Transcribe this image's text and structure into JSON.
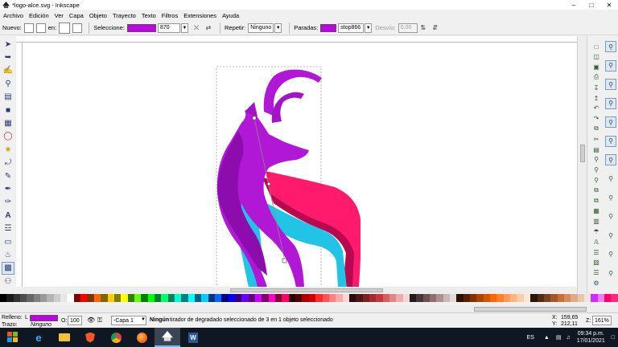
{
  "window": {
    "title": "*logo-alce.svg - Inkscape",
    "minimize_icon": "minimize-icon",
    "maximize_icon": "maximize-icon",
    "close_icon": "close-icon"
  },
  "menu": [
    "Archivo",
    "Edición",
    "Ver",
    "Capa",
    "Objeto",
    "Trayecto",
    "Texto",
    "Filtros",
    "Extensiones",
    "Ayuda"
  ],
  "tool_controls": {
    "nuevo_label": "Nuevo:",
    "en_label": "en:",
    "seleccione_label": "Seleccione:",
    "selection_color": "#c000e8",
    "selection_value": "870",
    "repetir_label": "Repetir:",
    "repetir_value": "Ninguno",
    "paradas_label": "Paradas:",
    "paradas_color": "#c000e8",
    "paradas_value": "stop866",
    "desvio_label": "Desvío:",
    "desvio_value": "0,00"
  },
  "tools": [
    "selector-icon",
    "node-icon",
    "tweak-icon",
    "zoom-icon",
    "measure-icon",
    "rectangle-icon",
    "3dbox-icon",
    "circle-icon",
    "star-icon",
    "spiral-icon",
    "pencil-icon",
    "pen-icon",
    "calligraphy-icon",
    "text-icon",
    "spray-icon",
    "eraser-icon",
    "bucket-icon",
    "gradient-icon",
    "dropper-icon"
  ],
  "commands": [
    "new-doc-icon",
    "open-icon",
    "save-icon",
    "print-icon",
    "import-icon",
    "export-icon",
    "undo-icon",
    "redo-icon",
    "copy-icon",
    "cut-icon",
    "paste-icon",
    "zoom-fit-icon",
    "zoom-drawing-icon",
    "zoom-page-icon",
    "duplicate-icon",
    "clone-icon",
    "group-icon",
    "ungroup-icon",
    "fill-stroke-icon",
    "text-font-icon",
    "layers-icon",
    "xml-editor-icon",
    "align-icon",
    "preferences-icon"
  ],
  "snap_controls": [
    "snap-enable-icon",
    "snap-bbox-icon",
    "snap-bbox-edge-icon",
    "snap-bbox-corner-icon",
    "snap-nodes-icon",
    "snap-path-icon",
    "snap-cusp-icon",
    "snap-smooth-icon",
    "snap-midpoint-icon",
    "snap-center-icon",
    "snap-rotation-icon",
    "snap-page-icon",
    "snap-grid-icon"
  ],
  "palette": [
    "#000000",
    "#1a1a1a",
    "#333333",
    "#4d4d4d",
    "#666666",
    "#808080",
    "#999999",
    "#b3b3b3",
    "#cccccc",
    "#e6e6e6",
    "#ffffff",
    "#800000",
    "#ff0000",
    "#803300",
    "#ff6600",
    "#806600",
    "#ffcc00",
    "#808000",
    "#ffff00",
    "#338000",
    "#66ff00",
    "#008000",
    "#00ff00",
    "#008033",
    "#00ff66",
    "#008066",
    "#00ffcc",
    "#008080",
    "#00ffff",
    "#006680",
    "#00ccff",
    "#003380",
    "#0066ff",
    "#000080",
    "#0000ff",
    "#330080",
    "#6600ff",
    "#660080",
    "#cc00ff",
    "#800066",
    "#ff00cc",
    "#800033",
    "#ff0066",
    "#2b0000",
    "#550000",
    "#aa0000",
    "#d40000",
    "#ff2a2a",
    "#ff5555",
    "#ff8080",
    "#ffaaaa",
    "#ffd5d5",
    "#280b0b",
    "#501616",
    "#782121",
    "#a02c2c",
    "#c83737",
    "#d35f5f",
    "#de8787",
    "#e9afaf",
    "#f4d7d7",
    "#241c1c",
    "#483737",
    "#6c5353",
    "#916f6f",
    "#ac9393",
    "#c8b7b7",
    "#e3dbdb",
    "#2b1100",
    "#552200",
    "#803300",
    "#aa4400",
    "#d45500",
    "#ff6600",
    "#ff7f2a",
    "#ff9955",
    "#ffb380",
    "#ffccaa",
    "#ffe6d5",
    "#28170b",
    "#502d16",
    "#784421",
    "#a05a2c",
    "#c87137",
    "#d38d5f",
    "#deaa87",
    "#e9c6af",
    "#f4e3d7",
    "#d42aff",
    "#e580ff",
    "#ff0066",
    "#ff2a7f"
  ],
  "status": {
    "relleno_label": "Relleno:",
    "relleno_letter": "L",
    "relleno_color": "#c000e8",
    "trazo_label": "Trazo:",
    "trazo_value": "Ninguno",
    "opacity_label": "O:",
    "opacity_value": "100",
    "layer_value": "-Capa 1",
    "message_bold": "Ningún",
    "message_rest": " tirador de degradado seleccionado de 3 en 1 objeto seleccionado",
    "x_label": "X:",
    "x_value": "159,65",
    "y_label": "Y:",
    "y_value": "212,11",
    "z_label": "Z:",
    "zoom_value": "161%"
  },
  "taskbar": {
    "apps": [
      "windows-start-icon",
      "ie-icon",
      "file-explorer-icon",
      "brave-icon",
      "chrome-icon",
      "firefox-icon",
      "inkscape-icon",
      "word-icon"
    ],
    "lang": "ES",
    "time": "09:34 p.m.",
    "date": "17/01/2021"
  }
}
